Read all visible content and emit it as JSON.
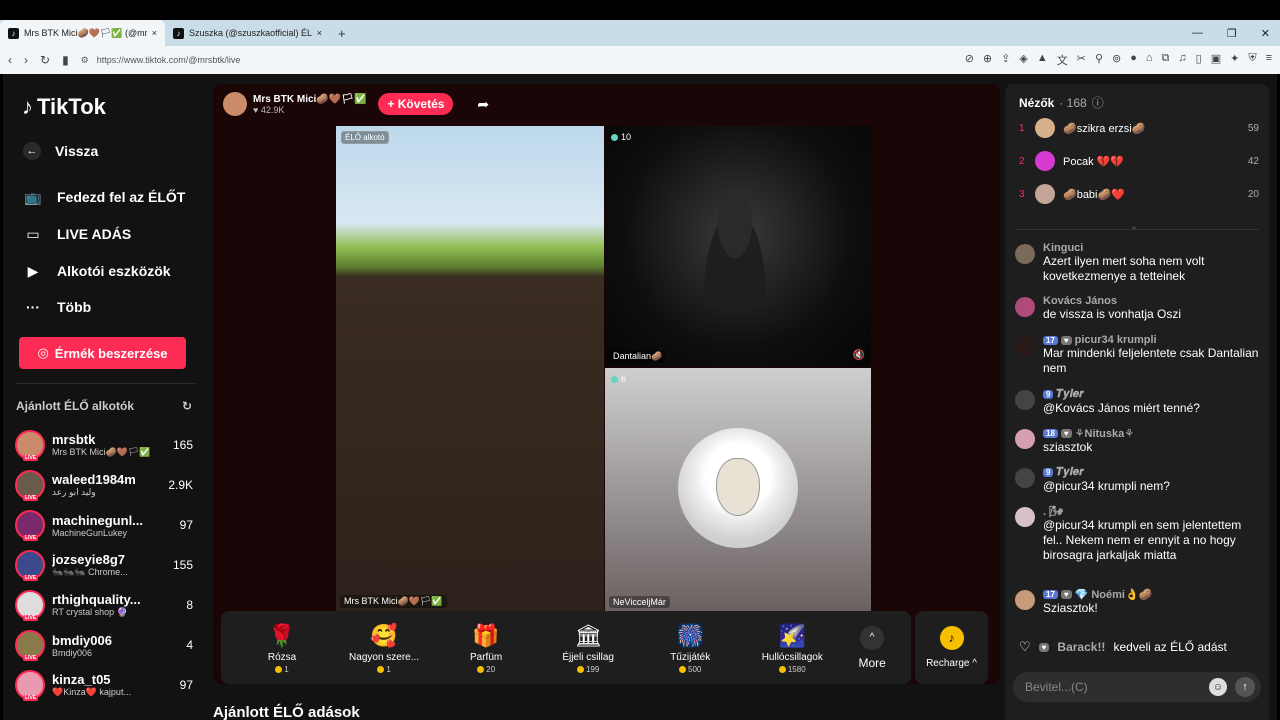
{
  "browser": {
    "tabs": [
      {
        "title": "Mrs BTK Mici🥔🤎🏳✅ (@mrsbtk)",
        "close": "×"
      },
      {
        "title": "Szuszka (@szuszkaofficial) ÉLŐ adás",
        "close": "×"
      }
    ],
    "new_tab": "+",
    "url": "https://www.tiktok.com/@mrsbtk/live"
  },
  "sidebar": {
    "logo": "TikTok",
    "back": "Vissza",
    "nav": [
      "Fedezd fel az ÉLŐT",
      "LIVE ADÁS",
      "Alkotói eszközök",
      "Több"
    ],
    "coins_button": "Érmék beszerzése",
    "recommended_title": "Ajánlott ÉLŐ alkotók",
    "live_badge": "LIVE",
    "creators": [
      {
        "name": "mrsbtk",
        "sub": "Mrs BTK Mici🥔🤎🏳✅",
        "count": "165"
      },
      {
        "name": "waleed1984m",
        "sub": "وليد ابو رعد",
        "count": "2.9K"
      },
      {
        "name": "machinegunl...",
        "sub": "MachineGunLukey",
        "count": "97"
      },
      {
        "name": "jozseyie8g7",
        "sub": "🐜🐜🐜 Chrome...",
        "count": "155"
      },
      {
        "name": "rthighquality...",
        "sub": "RT crystal shop 🔮",
        "count": "8"
      },
      {
        "name": "bmdiy006",
        "sub": "Bmdiy006",
        "count": "4"
      },
      {
        "name": "kinza_t05",
        "sub": "❤️Kinza❤️ kajput...",
        "count": "97"
      }
    ]
  },
  "stream": {
    "host_name": "Mrs BTK Mici🥔🤎🏳✅",
    "host_likes": "♥ 42.9K",
    "follow_label": "+ Követés",
    "creator_tag": "ÉLŐ alkotó",
    "main_label": "Mrs BTK Mici🥔🤎🏳✅",
    "guest1_count": "10",
    "guest1_label": "Dantalian🥔",
    "guest2_count": "6",
    "guest2_label": "NeVicceljMár"
  },
  "gifts": [
    {
      "name": "Rózsa",
      "price": "1",
      "icon": "🌹"
    },
    {
      "name": "Nagyon szere...",
      "price": "1",
      "icon": "🥰"
    },
    {
      "name": "Parfüm",
      "price": "20",
      "icon": "🎁"
    },
    {
      "name": "Éjjeli csillag",
      "price": "199",
      "icon": "🏛"
    },
    {
      "name": "Tűzijáték",
      "price": "500",
      "icon": "🎆"
    },
    {
      "name": "Hullócsillagok",
      "price": "1580",
      "icon": "🌠"
    }
  ],
  "more_label": "More",
  "recharge_label": "Recharge ^",
  "recommended_header": "Ajánlott ÉLŐ adások",
  "viewers": {
    "title": "Nézők",
    "count": "· 168",
    "list": [
      {
        "rank": "1",
        "name": "🥔szikra erzsi🥔",
        "score": "59",
        "color": "#d9b08c"
      },
      {
        "rank": "2",
        "name": "Pocak 💔💔",
        "score": "42",
        "color": "#d63ad1"
      },
      {
        "rank": "3",
        "name": "🥔babi🥔❤️",
        "score": "20",
        "color": "#c4a597"
      }
    ]
  },
  "chat": [
    {
      "name": "Kinguci",
      "badges": [],
      "text": "Azert ilyen mert soha nem volt kovetkezmenye a tetteinek",
      "color": "#7a6a5a"
    },
    {
      "name": "Kovács János",
      "badges": [],
      "text": "de vissza is vonhatja Oszi",
      "color": "#b04a7a"
    },
    {
      "name": "picur34 krumpli",
      "badges": [
        "17",
        "♥"
      ],
      "text": "Mar mindenki feljelentete csak Dantalian nem",
      "color": "#2a1a1a"
    },
    {
      "name": "𝑻𝒚𝒍𝒆𝒓",
      "badges": [
        "9"
      ],
      "text": "@Kovács János miért tenné?",
      "color": "#444"
    },
    {
      "name": "⚘Nituska⚘",
      "badges": [
        "18",
        "♥"
      ],
      "text": "sziasztok",
      "color": "#d4a0b0"
    },
    {
      "name": "𝑻𝒚𝒍𝒆𝒓",
      "badges": [
        "9"
      ],
      "text": "@picur34 krumpli nem?",
      "color": "#444"
    },
    {
      "name": ". 🌬",
      "badges": [],
      "text": "@picur34 krumpli en sem jelentettem fel.. Nekem nem er ennyit a no hogy birosagra jarkaljak miatta",
      "color": "#d8c0c8"
    },
    {
      "name": "Noémi👌🥔",
      "badges": [
        "17",
        "♥",
        "💎"
      ],
      "text": "Sziasztok!",
      "color": "#c89a7a"
    }
  ],
  "heart_event": {
    "badge": "♥",
    "name": "Barack!!",
    "text": "kedveli az ÉLŐ adást"
  },
  "input_placeholder": "Bevitel...(C)"
}
